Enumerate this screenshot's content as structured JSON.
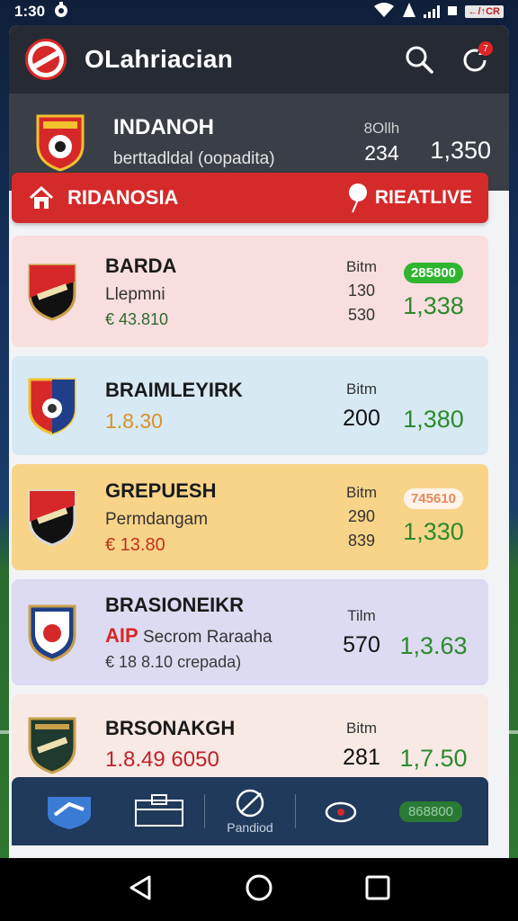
{
  "status_bar": {
    "time": "1:30",
    "battery": "←/↑CR"
  },
  "header": {
    "app_title": "OLahriacian",
    "notification_count": "7"
  },
  "featured": {
    "team": "INDANOH",
    "subtitle": "berttadldal (oopadita)",
    "stat_label": "8Ollh",
    "stat_value": "234",
    "odds": "1,350"
  },
  "section": {
    "title": "RIDANOSIA",
    "right_label": "RIEATLIVE"
  },
  "matches": [
    {
      "team": "BARDA",
      "line2": "Llepmni",
      "line3": "€ 43.810",
      "stat_label": "Bitm",
      "stat_v1": "130",
      "stat_v2": "530",
      "badge": "285800",
      "odds": "1,338",
      "bg": "#f8dede"
    },
    {
      "team": "BRAIMLEYIRK",
      "line2": "1.8.30",
      "stat_label": "Bitm",
      "stat_big": "200",
      "odds": "1,380",
      "bg": "#d7e9f3"
    },
    {
      "team": "GREPUESH",
      "line2": "Permdangam",
      "line3": "€ 13.80",
      "stat_label": "Bitm",
      "stat_v1": "290",
      "stat_v2": "839",
      "badge": "745610",
      "odds": "1,330",
      "bg": "#f8d489"
    },
    {
      "team": "BRASIONEIKR",
      "line2_prefix": "AIP",
      "line2": "Secrom Raraaha",
      "line3": "€ 18 8.10 crepada)",
      "stat_label": "Tilm",
      "stat_big": "570",
      "odds": "1,3.63",
      "bg": "#dcdbf1"
    },
    {
      "team": "BRSONAKGH",
      "line2": "1.8.49 6050",
      "stat_label": "Bitm",
      "stat_big": "281",
      "odds": "1,7.50",
      "bg": "#f8e9e5"
    }
  ],
  "tabbar": {
    "tab_label": "Pandiod",
    "badge": "868800"
  },
  "colors": {
    "accent_red": "#d42a2a",
    "odds_green": "#2c8a2c",
    "header_dark": "#262b33",
    "tab_blue": "#1f3a5b"
  }
}
